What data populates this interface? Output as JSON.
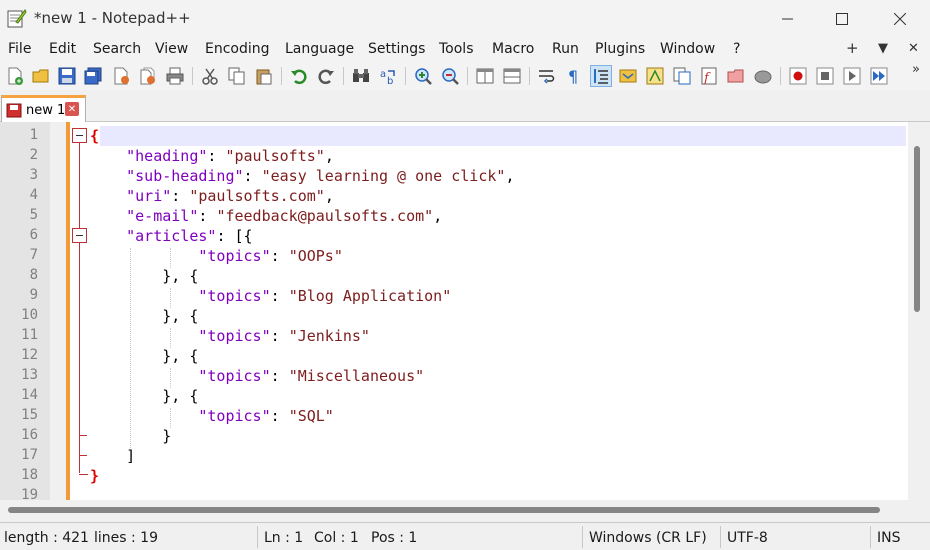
{
  "window": {
    "title": "*new 1 - Notepad++"
  },
  "menu": {
    "items": [
      "File",
      "Edit",
      "Search",
      "View",
      "Encoding",
      "Language",
      "Settings",
      "Tools",
      "Macro",
      "Run",
      "Plugins",
      "Window",
      "?"
    ],
    "right_plus": "+",
    "right_down": "▼",
    "right_close": "✕"
  },
  "tabs": [
    {
      "label": "new 1",
      "active": true
    }
  ],
  "editor": {
    "line_numbers": [
      "1",
      "2",
      "3",
      "4",
      "5",
      "6",
      "7",
      "8",
      "9",
      "10",
      "11",
      "12",
      "13",
      "14",
      "15",
      "16",
      "17",
      "18",
      "19"
    ],
    "lines": [
      [
        {
          "t": "{",
          "c": "brace-red"
        }
      ],
      [
        {
          "t": "    ",
          "c": "punc"
        },
        {
          "t": "\"heading\"",
          "c": "key"
        },
        {
          "t": ": ",
          "c": "punc"
        },
        {
          "t": "\"paulsofts\"",
          "c": "str"
        },
        {
          "t": ",",
          "c": "punc"
        }
      ],
      [
        {
          "t": "    ",
          "c": "punc"
        },
        {
          "t": "\"sub-heading\"",
          "c": "key"
        },
        {
          "t": ": ",
          "c": "punc"
        },
        {
          "t": "\"easy learning @ one click\"",
          "c": "str"
        },
        {
          "t": ",",
          "c": "punc"
        }
      ],
      [
        {
          "t": "    ",
          "c": "punc"
        },
        {
          "t": "\"uri\"",
          "c": "key"
        },
        {
          "t": ": ",
          "c": "punc"
        },
        {
          "t": "\"paulsofts.com\"",
          "c": "str"
        },
        {
          "t": ",",
          "c": "punc"
        }
      ],
      [
        {
          "t": "    ",
          "c": "punc"
        },
        {
          "t": "\"e-mail\"",
          "c": "key"
        },
        {
          "t": ": ",
          "c": "punc"
        },
        {
          "t": "\"feedback@paulsofts.com\"",
          "c": "str"
        },
        {
          "t": ",",
          "c": "punc"
        }
      ],
      [
        {
          "t": "    ",
          "c": "punc"
        },
        {
          "t": "\"articles\"",
          "c": "key"
        },
        {
          "t": ": [{",
          "c": "punc"
        }
      ],
      [
        {
          "t": "            ",
          "c": "punc"
        },
        {
          "t": "\"topics\"",
          "c": "key"
        },
        {
          "t": ": ",
          "c": "punc"
        },
        {
          "t": "\"OOPs\"",
          "c": "str"
        }
      ],
      [
        {
          "t": "        }, {",
          "c": "punc"
        }
      ],
      [
        {
          "t": "            ",
          "c": "punc"
        },
        {
          "t": "\"topics\"",
          "c": "key"
        },
        {
          "t": ": ",
          "c": "punc"
        },
        {
          "t": "\"Blog Application\"",
          "c": "str"
        }
      ],
      [
        {
          "t": "        }, {",
          "c": "punc"
        }
      ],
      [
        {
          "t": "            ",
          "c": "punc"
        },
        {
          "t": "\"topics\"",
          "c": "key"
        },
        {
          "t": ": ",
          "c": "punc"
        },
        {
          "t": "\"Jenkins\"",
          "c": "str"
        }
      ],
      [
        {
          "t": "        }, {",
          "c": "punc"
        }
      ],
      [
        {
          "t": "            ",
          "c": "punc"
        },
        {
          "t": "\"topics\"",
          "c": "key"
        },
        {
          "t": ": ",
          "c": "punc"
        },
        {
          "t": "\"Miscellaneous\"",
          "c": "str"
        }
      ],
      [
        {
          "t": "        }, {",
          "c": "punc"
        }
      ],
      [
        {
          "t": "            ",
          "c": "punc"
        },
        {
          "t": "\"topics\"",
          "c": "key"
        },
        {
          "t": ": ",
          "c": "punc"
        },
        {
          "t": "\"SQL\"",
          "c": "str"
        }
      ],
      [
        {
          "t": "        }",
          "c": "punc"
        }
      ],
      [
        {
          "t": "    ]",
          "c": "punc"
        }
      ],
      [
        {
          "t": "}",
          "c": "brace-red"
        }
      ],
      [
        {
          "t": "",
          "c": "punc"
        }
      ]
    ]
  },
  "status": {
    "length": "length : 421",
    "lines": "lines : 19",
    "ln": "Ln : 1",
    "col": "Col : 1",
    "pos": "Pos : 1",
    "eol": "Windows (CR LF)",
    "encoding": "UTF-8",
    "mode": "INS"
  },
  "colors": {
    "accent_tab": "#f5a341",
    "change_bar": "#f29b3a",
    "json_key": "#8000c0",
    "json_string": "#7d1d1d",
    "brace": "#e00000",
    "current_line": "#e8e8ff"
  },
  "toolbar_icons": [
    "new-file-icon",
    "open-file-icon",
    "save-icon",
    "save-all-icon",
    "close-icon",
    "close-all-icon",
    "print-icon",
    "cut-icon",
    "copy-icon",
    "paste-icon",
    "undo-icon",
    "redo-icon",
    "find-icon",
    "replace-icon",
    "zoom-in-icon",
    "zoom-out-icon",
    "sync-vertical-icon",
    "sync-horizontal-icon",
    "word-wrap-icon",
    "show-all-chars-icon",
    "indent-guide-icon",
    "udl-icon",
    "doc-map-icon",
    "doc-list-icon",
    "function-list-icon",
    "folder-workspace-icon",
    "monitoring-icon",
    "record-macro-icon",
    "stop-macro-icon",
    "play-macro-icon",
    "run-macro-multiple-icon"
  ]
}
